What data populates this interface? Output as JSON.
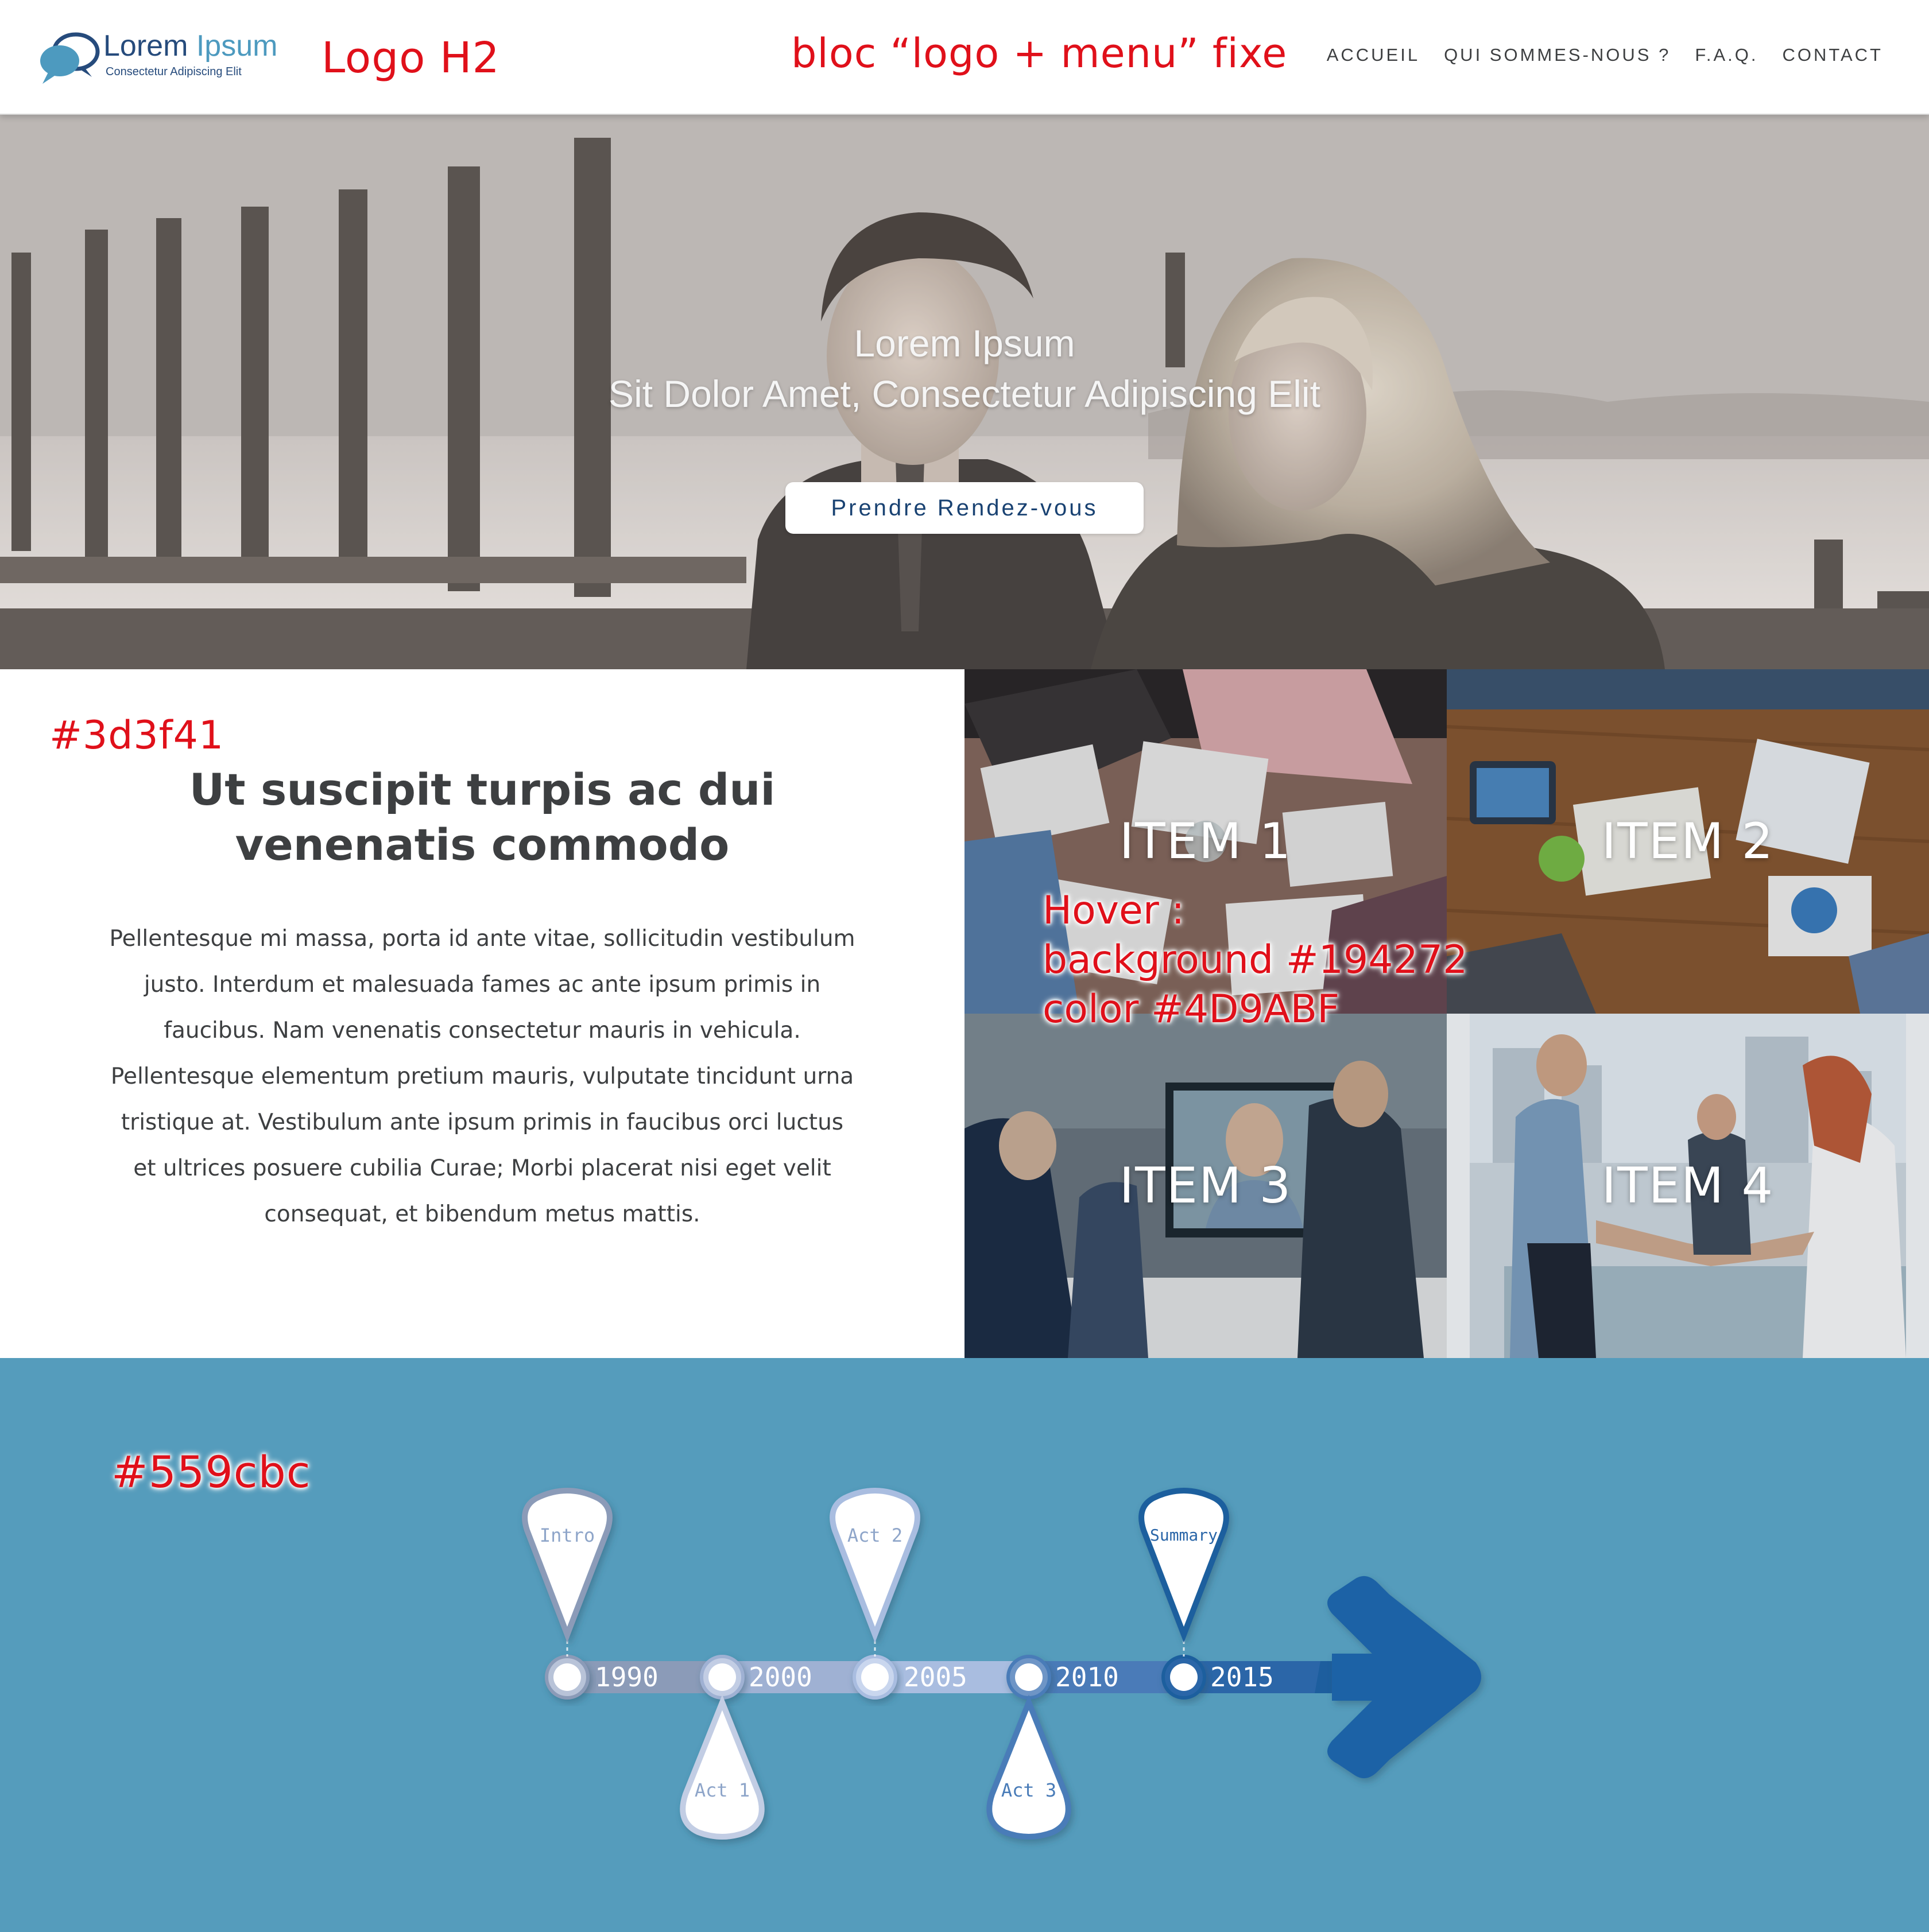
{
  "nav": {
    "logo_word1": "Lorem",
    "logo_word2": "Ipsum",
    "logo_sub": "Consectetur Adipiscing Elit",
    "annotation_logo": "Logo H2",
    "annotation_bloc": "bloc “logo + menu” fixe",
    "menu": [
      "ACCUEIL",
      "QUI SOMMES-NOUS ?",
      "F.A.Q.",
      "CONTACT"
    ]
  },
  "hero": {
    "title": "Lorem Ipsum",
    "subtitle": "Sit Dolor Amet, Consectetur Adipiscing Elit",
    "button": "Prendre Rendez-vous"
  },
  "content": {
    "annotation_color": "#3d3f41",
    "title_line1": "Ut suscipit turpis ac dui",
    "title_line2": "venenatis commodo",
    "paragraph_lines": [
      "Pellentesque mi massa, porta id ante vitae, sollicitudin vestibulum",
      "justo. Interdum et malesuada fames ac ante ipsum primis in",
      "faucibus. Nam venenatis consectetur mauris in vehicula.",
      "Pellentesque elementum pretium mauris, vulputate tincidunt urna",
      "tristique at. Vestibulum ante ipsum primis in faucibus orci luctus",
      "et ultrices posuere cubilia Curae; Morbi placerat nisi eget velit",
      "consequat, et bibendum metus mattis."
    ]
  },
  "grid": {
    "items": [
      "ITEM 1",
      "ITEM 2",
      "ITEM 3",
      "ITEM 4"
    ],
    "hover_note": [
      "Hover :",
      "background #194272",
      "color #4D9ABF"
    ]
  },
  "timeline": {
    "annotation_color": "#559cbc",
    "years": [
      "1990",
      "2000",
      "2005",
      "2010",
      "2015"
    ],
    "pins_top": [
      "Intro",
      "Act 2",
      "Summary"
    ],
    "pins_bottom": [
      "Act 1",
      "Act 3"
    ]
  },
  "colors": {
    "text_dark": "#3d3f41",
    "hover_background": "#194272",
    "hover_color": "#4D9ABF",
    "timeline_background": "#559cbc",
    "annotation_red": "#e0101a"
  }
}
